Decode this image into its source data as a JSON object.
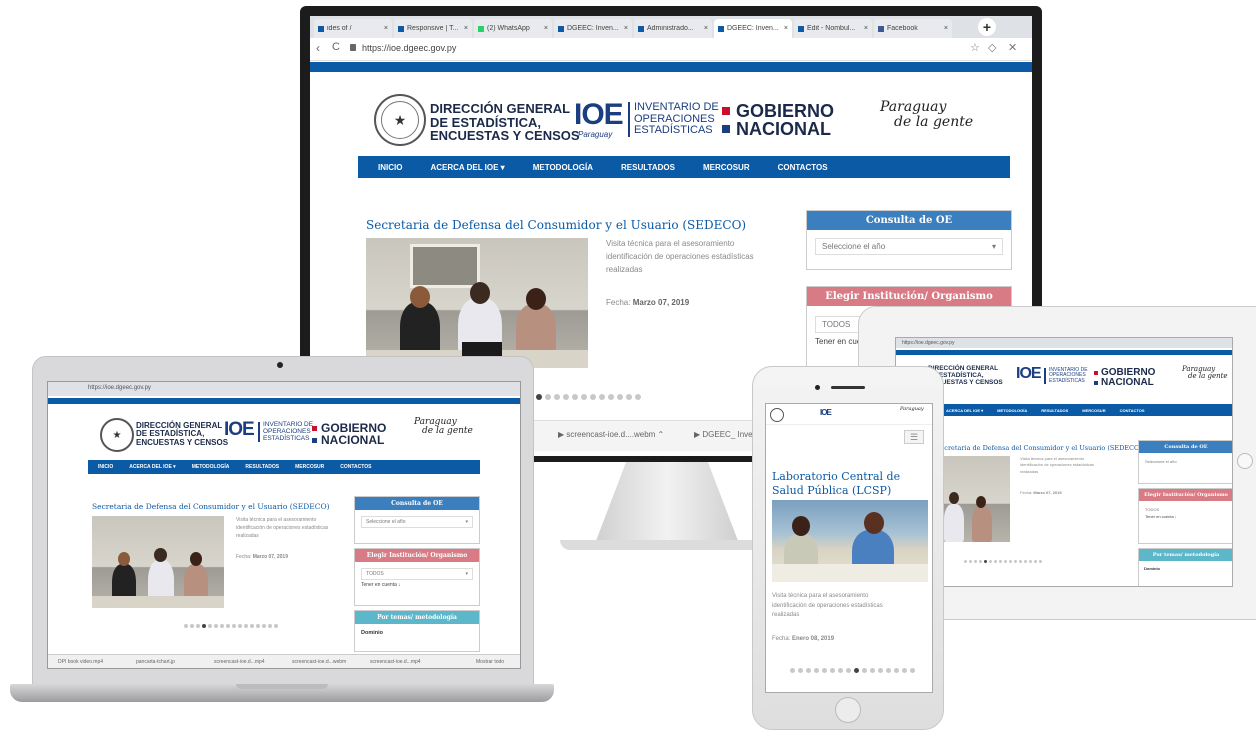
{
  "browser": {
    "tabs": [
      "ides of /",
      "Responsive | T...",
      "(2) WhatsApp",
      "DGEEC: Inven...",
      "Administrado...",
      "DGEEC: Inven...",
      "Edit - Nombul...",
      "Facebook"
    ],
    "url": "https://ioe.dgeec.gov.py",
    "new_tab": "+"
  },
  "site": {
    "dgeec": [
      "DIRECCIÓN GENERAL",
      "DE ESTADÍSTICA,",
      "ENCUESTAS Y CENSOS"
    ],
    "ioe": "IOE",
    "ioe_sub": "Paraguay",
    "ioe_lines": [
      "INVENTARIO DE",
      "OPERACIONES",
      "ESTADÍSTICAS"
    ],
    "gobierno": [
      "GOBIERNO",
      "NACIONAL"
    ],
    "slogan": [
      "Paraguay",
      "de la gente"
    ],
    "nav": [
      "INICIO",
      "ACERCA DEL IOE ▾",
      "METODOLOGÍA",
      "RESULTADOS",
      "MERCOSUR",
      "CONTACTOS"
    ],
    "post_title": "Secretaria de Defensa del Consumidor y el Usuario (SEDECO)",
    "post_text": [
      "Visita técnica para el asesoramiento",
      "identificación de operaciones estadísticas",
      "realizadas"
    ],
    "post_date_label": "Fecha:",
    "post_date": "Marzo 07, 2019",
    "widget1_title": "Consulta de OE",
    "widget1_select": "Seleccione el año",
    "widget2_title": "Elegir Institución/ Organismo",
    "widget2_select": "TODOS",
    "widget2_link": "Tener en cuenta ↓",
    "widget3_title": "Por temas/ metodología",
    "widget3_item": "Dominio",
    "caret": "▾"
  },
  "phone_site": {
    "post_title": "Laboratorio Central de Salud Pública (LCSP)",
    "post_text": [
      "Visita técnica para el asesoramiento",
      "identificación de operaciones estadísticas",
      "realizadas"
    ],
    "post_date_label": "Fecha:",
    "post_date": "Enero 08, 2019",
    "menu_icon": "☰"
  },
  "downloads": {
    "items": [
      "screencast-ioe.d....webm",
      "DGEEC_ Inve...",
      "DPI book video.mp4",
      "pancarta-tchart.jp",
      "screencast-ioe.d...mp4",
      "screencast-ioe.d...webm",
      "screencast-ioe.d...mp4"
    ],
    "show_all": "Mostrar todo"
  },
  "colors": {
    "nav_blue": "#0b5aa6",
    "widget_blue": "#3b7fbf",
    "widget_red": "#d97b84",
    "widget_teal": "#5bb7c9",
    "gob_red": "#c8102e",
    "gob_blue": "#1b3e80"
  }
}
